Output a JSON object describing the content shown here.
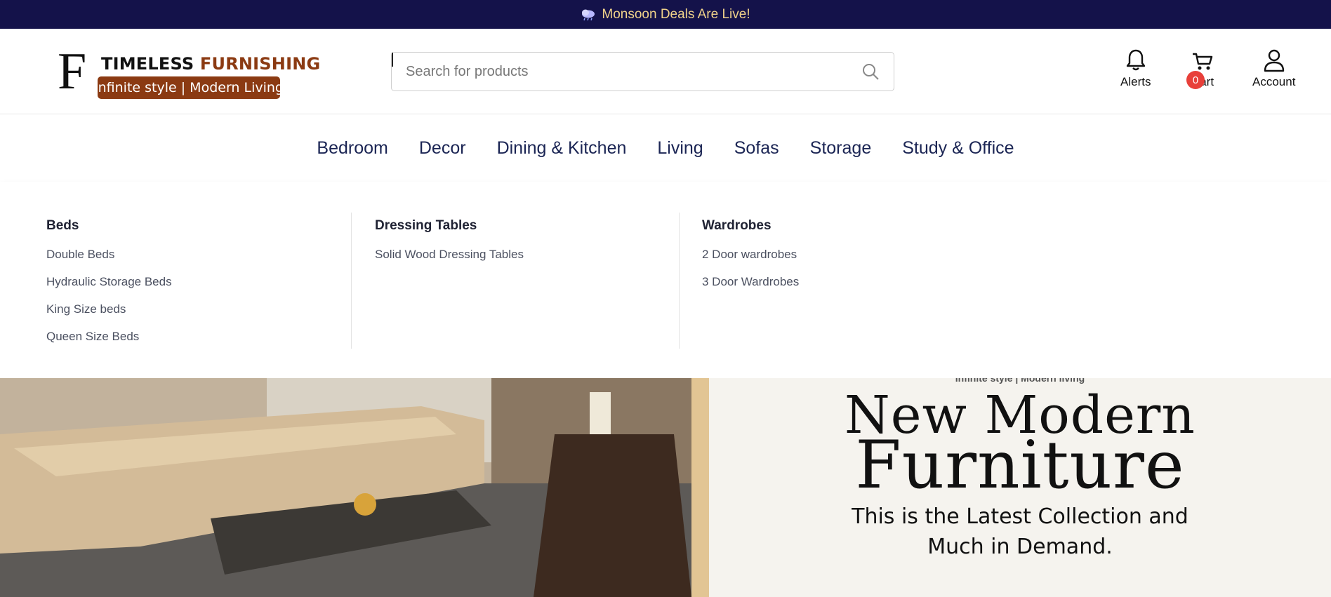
{
  "announcement": {
    "text": "Monsoon Deals Are Live!",
    "icon": "rain-cloud-icon"
  },
  "logo": {
    "letter": "F",
    "brand_part1": "TIMELESS ",
    "brand_part2": "FURNISHING",
    "tagline": "Infinite style | Modern Living"
  },
  "search": {
    "placeholder": "Search for products"
  },
  "header_actions": {
    "alerts": "Alerts",
    "cart": "Cart",
    "cart_count": "0",
    "account": "Account"
  },
  "nav": [
    "Bedroom",
    "Decor",
    "Dining & Kitchen",
    "Living",
    "Sofas",
    "Storage",
    "Study & Office"
  ],
  "mega_menu": [
    {
      "heading": "Beds",
      "links": [
        "Double Beds",
        "Hydraulic Storage Beds",
        "King Size beds",
        "Queen Size Beds"
      ]
    },
    {
      "heading": "Dressing Tables",
      "links": [
        "Solid Wood Dressing Tables"
      ]
    },
    {
      "heading": "Wardrobes",
      "links": [
        "2 Door wardrobes",
        "3 Door Wardrobes"
      ]
    }
  ],
  "hero": {
    "small": "Infinite style | Modern living",
    "title_line1": "New Modern",
    "title_line2": "Furniture",
    "subtitle_line1": "This is the Latest Collection and",
    "subtitle_line2": "Much in Demand."
  },
  "colors": {
    "topbar_bg": "#14124a",
    "topbar_text": "#f0d28a",
    "brand_accent": "#8b3a12",
    "nav_text": "#1b2554",
    "badge": "#e8403a"
  }
}
